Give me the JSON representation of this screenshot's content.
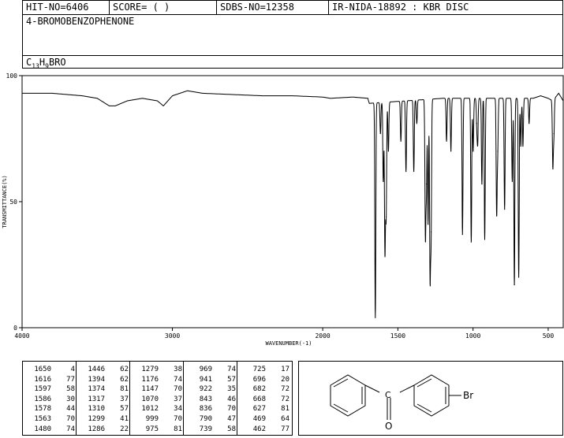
{
  "header": {
    "hit_no": "HIT-NO=6406",
    "score": "SCORE=  (   )",
    "sdbs_no": "SDBS-NO=12358",
    "ir_nida": "IR-NIDA-18892 : KBR DISC",
    "compound_name": "4-BROMOBENZOPHENONE",
    "formula": {
      "c": "C",
      "c_n": "13",
      "h": "H",
      "h_n": "9",
      "rest": "BRO"
    }
  },
  "chart_data": {
    "type": "line",
    "title": "",
    "xlabel": "WAVENUMBER(-1)",
    "ylabel": "TRANSMITTANCE(%)",
    "xlim": [
      4000,
      400
    ],
    "ylim": [
      0,
      100
    ],
    "x_ticks": [
      4000,
      3000,
      2000,
      1500,
      1000,
      500
    ],
    "x_tick_labels": [
      "4000",
      "3000",
      "2000",
      "1500",
      "1000",
      "500"
    ],
    "y_ticks": [
      0,
      50,
      100
    ],
    "y_tick_labels": [
      "0",
      "50",
      "100"
    ],
    "grid": false,
    "baseline": [
      [
        4000,
        93
      ],
      [
        3800,
        93
      ],
      [
        3600,
        92
      ],
      [
        3500,
        91
      ],
      [
        3420,
        88
      ],
      [
        3380,
        88
      ],
      [
        3300,
        90
      ],
      [
        3200,
        91
      ],
      [
        3100,
        90
      ],
      [
        3060,
        88
      ],
      [
        3000,
        92
      ],
      [
        2900,
        94
      ],
      [
        2800,
        93
      ],
      [
        2600,
        92.5
      ],
      [
        2400,
        92
      ],
      [
        2200,
        92
      ],
      [
        2000,
        91.5
      ],
      [
        1950,
        91
      ],
      [
        1800,
        91.5
      ],
      [
        1700,
        91
      ],
      [
        1690,
        89
      ],
      [
        1200,
        91
      ],
      [
        800,
        91
      ],
      [
        600,
        91
      ],
      [
        550,
        92
      ],
      [
        500,
        91
      ],
      [
        470,
        90
      ],
      [
        430,
        93
      ],
      [
        400,
        90
      ]
    ],
    "series": [
      {
        "peaks": [
          {
            "x": 1650,
            "y": 4
          },
          {
            "x": 1616,
            "y": 77
          },
          {
            "x": 1597,
            "y": 58
          },
          {
            "x": 1586,
            "y": 30
          },
          {
            "x": 1578,
            "y": 44
          },
          {
            "x": 1563,
            "y": 70
          },
          {
            "x": 1480,
            "y": 74
          },
          {
            "x": 1446,
            "y": 62
          },
          {
            "x": 1394,
            "y": 62
          },
          {
            "x": 1374,
            "y": 81
          },
          {
            "x": 1317,
            "y": 37
          },
          {
            "x": 1310,
            "y": 57
          },
          {
            "x": 1299,
            "y": 41
          },
          {
            "x": 1286,
            "y": 22
          },
          {
            "x": 1279,
            "y": 38
          },
          {
            "x": 1176,
            "y": 74
          },
          {
            "x": 1147,
            "y": 70
          },
          {
            "x": 1070,
            "y": 37
          },
          {
            "x": 1012,
            "y": 34
          },
          {
            "x": 999,
            "y": 70
          },
          {
            "x": 975,
            "y": 81
          },
          {
            "x": 969,
            "y": 74
          },
          {
            "x": 941,
            "y": 57
          },
          {
            "x": 922,
            "y": 35
          },
          {
            "x": 843,
            "y": 46
          },
          {
            "x": 836,
            "y": 70
          },
          {
            "x": 790,
            "y": 47
          },
          {
            "x": 739,
            "y": 58
          },
          {
            "x": 725,
            "y": 17
          },
          {
            "x": 696,
            "y": 20
          },
          {
            "x": 682,
            "y": 72
          },
          {
            "x": 668,
            "y": 72
          },
          {
            "x": 627,
            "y": 81
          },
          {
            "x": 469,
            "y": 64
          },
          {
            "x": 462,
            "y": 77
          }
        ]
      }
    ]
  },
  "peak_table": [
    [
      {
        "w": "1650",
        "t": "4"
      },
      {
        "w": "1616",
        "t": "77"
      },
      {
        "w": "1597",
        "t": "58"
      },
      {
        "w": "1586",
        "t": "30"
      },
      {
        "w": "1578",
        "t": "44"
      },
      {
        "w": "1563",
        "t": "70"
      },
      {
        "w": "1480",
        "t": "74"
      }
    ],
    [
      {
        "w": "1446",
        "t": "62"
      },
      {
        "w": "1394",
        "t": "62"
      },
      {
        "w": "1374",
        "t": "81"
      },
      {
        "w": "1317",
        "t": "37"
      },
      {
        "w": "1310",
        "t": "57"
      },
      {
        "w": "1299",
        "t": "41"
      },
      {
        "w": "1286",
        "t": "22"
      }
    ],
    [
      {
        "w": "1279",
        "t": "38"
      },
      {
        "w": "1176",
        "t": "74"
      },
      {
        "w": "1147",
        "t": "70"
      },
      {
        "w": "1070",
        "t": "37"
      },
      {
        "w": "1012",
        "t": "34"
      },
      {
        "w": "999",
        "t": "70"
      },
      {
        "w": "975",
        "t": "81"
      }
    ],
    [
      {
        "w": "969",
        "t": "74"
      },
      {
        "w": "941",
        "t": "57"
      },
      {
        "w": "922",
        "t": "35"
      },
      {
        "w": "843",
        "t": "46"
      },
      {
        "w": "836",
        "t": "70"
      },
      {
        "w": "790",
        "t": "47"
      },
      {
        "w": "739",
        "t": "58"
      }
    ],
    [
      {
        "w": "725",
        "t": "17"
      },
      {
        "w": "696",
        "t": "20"
      },
      {
        "w": "682",
        "t": "72"
      },
      {
        "w": "668",
        "t": "72"
      },
      {
        "w": "627",
        "t": "81"
      },
      {
        "w": "469",
        "t": "64"
      },
      {
        "w": "462",
        "t": "77"
      }
    ]
  ],
  "structure": {
    "br_label": "Br",
    "o_label": "O",
    "c_label": "C"
  }
}
